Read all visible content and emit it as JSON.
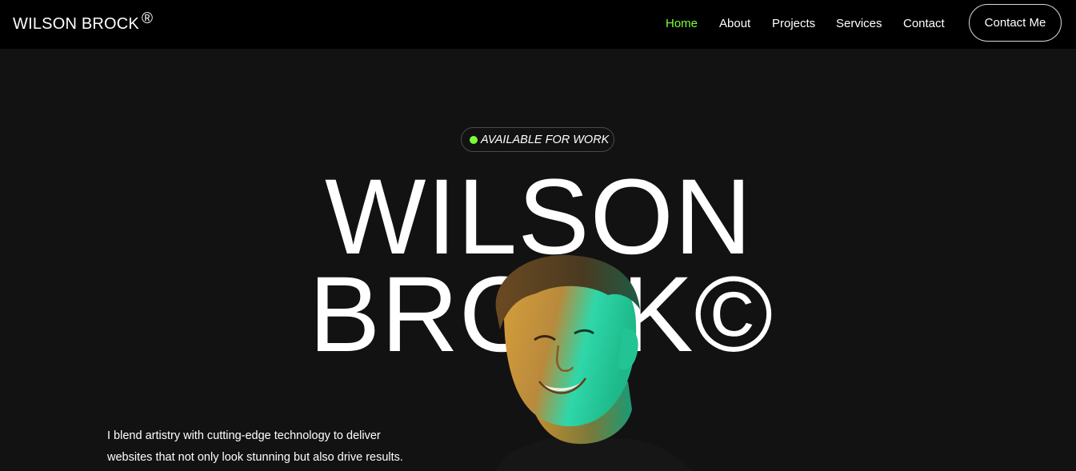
{
  "brand": {
    "name": "WILSON BROCK",
    "mark": "®"
  },
  "nav": {
    "items": [
      {
        "label": "Home",
        "active": true
      },
      {
        "label": "About",
        "active": false
      },
      {
        "label": "Projects",
        "active": false
      },
      {
        "label": "Services",
        "active": false
      },
      {
        "label": "Contact",
        "active": false
      }
    ],
    "cta_label": "Contact Me"
  },
  "hero": {
    "badge_label": "AVAILABLE FOR WORK",
    "title_line1": "WILSON",
    "title_line2": "BROCK©",
    "tagline_line1": "I blend artistry with cutting-edge technology to deliver",
    "tagline_line2": "websites that not only look stunning but also drive results."
  },
  "colors": {
    "accent": "#7cff3a",
    "nav_bg": "#000000",
    "page_bg": "#121212",
    "text": "#ffffff"
  },
  "icons": {
    "badge_status": "status-dot-icon",
    "portrait": "person-photo"
  }
}
